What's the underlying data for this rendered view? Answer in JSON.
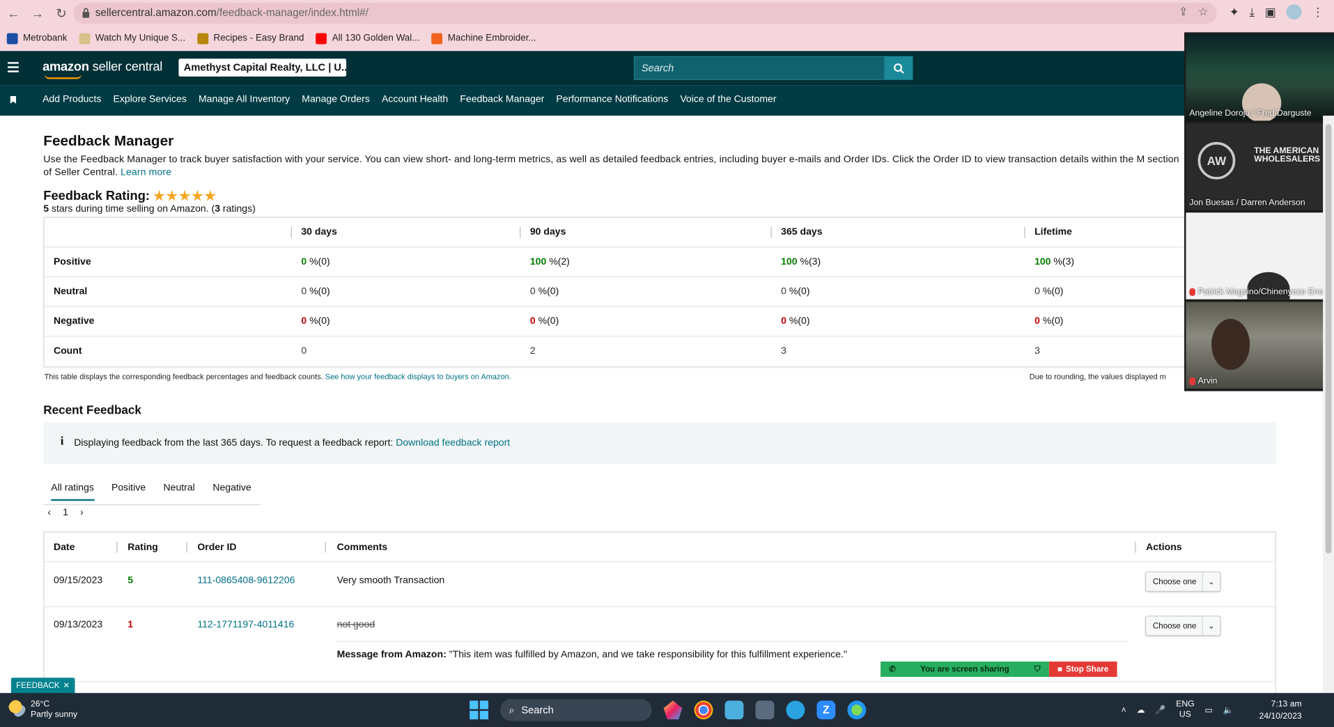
{
  "browser": {
    "url_domain": "sellercentral.amazon.com",
    "url_path": "/feedback-manager/index.html#/",
    "bookmarks": [
      {
        "label": "Metrobank",
        "color": "#1a4fa3"
      },
      {
        "label": "Watch My Unique S...",
        "color": "#d8c08a"
      },
      {
        "label": "Recipes - Easy Brand",
        "color": "#b8860b"
      },
      {
        "label": "All 130 Golden Wal...",
        "color": "#ff0000"
      },
      {
        "label": "Machine Embroider...",
        "color": "#f1641e"
      }
    ]
  },
  "header": {
    "logo_amazon": "amazon",
    "logo_rest": " seller central",
    "account": "Amethyst Capital Realty, LLC | U...",
    "search_placeholder": "Search"
  },
  "nav": {
    "items": [
      "Add Products",
      "Explore Services",
      "Manage All Inventory",
      "Manage Orders",
      "Account Health",
      "Feedback Manager",
      "Performance Notifications",
      "Voice of the Customer"
    ]
  },
  "page": {
    "title": "Feedback Manager",
    "description": "Use the Feedback Manager to track buyer satisfaction with your service. You can view short- and long-term metrics, as well as detailed feedback entries, including buyer e-mails and Order IDs. Click the Order ID to view transaction details within the M",
    "description_line2": "section of Seller Central.",
    "learn_more": "Learn more",
    "rating_label": "Feedback Rating:",
    "rating_stars": 5,
    "rating_sub_stars": "5",
    "rating_sub_mid": " stars during time selling on Amazon. (",
    "rating_sub_count": "3",
    "rating_sub_end": " ratings)"
  },
  "metrics": {
    "columns": [
      "30 days",
      "90 days",
      "365 days",
      "Lifetime"
    ],
    "rows": [
      {
        "label": "Positive",
        "cells": [
          {
            "n": "0",
            "p": " %(0)",
            "c": "green"
          },
          {
            "n": "100",
            "p": " %(2)",
            "c": "green"
          },
          {
            "n": "100",
            "p": " %(3)",
            "c": "green"
          },
          {
            "n": "100",
            "p": " %(3)",
            "c": "green"
          }
        ]
      },
      {
        "label": "Neutral",
        "cells": [
          {
            "n": "0",
            "p": " %(0)",
            "c": "gray"
          },
          {
            "n": "0",
            "p": " %(0)",
            "c": "gray"
          },
          {
            "n": "0",
            "p": " %(0)",
            "c": "gray"
          },
          {
            "n": "0",
            "p": " %(0)",
            "c": "gray"
          }
        ]
      },
      {
        "label": "Negative",
        "cells": [
          {
            "n": "0",
            "p": " %(0)",
            "c": "red"
          },
          {
            "n": "0",
            "p": " %(0)",
            "c": "red"
          },
          {
            "n": "0",
            "p": " %(0)",
            "c": "red"
          },
          {
            "n": "0",
            "p": " %(0)",
            "c": "red"
          }
        ]
      },
      {
        "label": "Count",
        "cells": [
          {
            "n": "0",
            "p": "",
            "c": "gray"
          },
          {
            "n": "2",
            "p": "",
            "c": "gray"
          },
          {
            "n": "3",
            "p": "",
            "c": "gray"
          },
          {
            "n": "3",
            "p": "",
            "c": "gray"
          }
        ]
      }
    ],
    "note": "This table displays the corresponding feedback percentages and feedback counts. ",
    "note_link": "See how your feedback displays to buyers on Amazon.",
    "note_right": "Due to rounding, the values displayed m"
  },
  "recent": {
    "title": "Recent Feedback",
    "info": "Displaying feedback from the last 365 days. To request a feedback report: ",
    "info_link": "Download feedback report",
    "tabs": [
      "All ratings",
      "Positive",
      "Neutral",
      "Negative"
    ],
    "page": "1",
    "columns": [
      "Date",
      "Rating",
      "Order ID",
      "Comments",
      "Actions"
    ],
    "rows": [
      {
        "date": "09/15/2023",
        "rating": "5",
        "order": "111-0865408-9612206",
        "comment": "Very smooth Transaction",
        "action": "Choose one"
      },
      {
        "date": "09/13/2023",
        "rating": "1",
        "order": "112-1771197-4011416",
        "comment": "not good",
        "action": "Choose one",
        "msg_label": "Message from Amazon:",
        "msg": " \"This item was fulfilled by Amazon, and we take responsibility for this fulfillment experience.\""
      }
    ]
  },
  "overlay": {
    "feedback_tab": "FEEDBACK",
    "sharing": "You are screen sharing",
    "stop_share": "Stop Share"
  },
  "video": {
    "participants": [
      "Angeline Doroja / Fred Darguste",
      "Jon Buesas / Darren Anderson",
      "Patrick Magsino/Chinenyeze Enw",
      "Arvin"
    ],
    "logo_text": "THE AMERICAN WHOLESALERS"
  },
  "taskbar": {
    "temp": "26°C",
    "weather": "Partly sunny",
    "search": "Search",
    "lang1": "ENG",
    "lang2": "US",
    "time": "7:13 am",
    "date": "24/10/2023"
  }
}
